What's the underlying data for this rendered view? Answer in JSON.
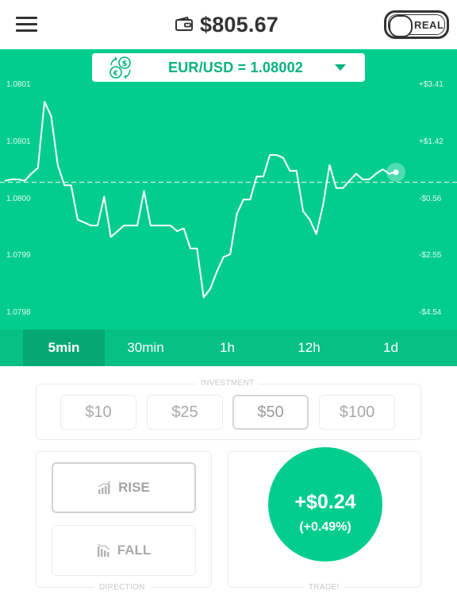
{
  "header": {
    "menu_icon": "hamburger-menu-icon",
    "wallet_icon": "wallet-icon",
    "balance": "$805.67",
    "account_toggle_label": "REAL"
  },
  "pair": {
    "icon": "currency-exchange-icon",
    "label": "EUR/USD = 1.08002",
    "dropdown_icon": "caret-down-icon"
  },
  "chart_data": {
    "type": "line",
    "y_left_ticks": [
      "1.0801",
      "1.0801",
      "1.0800",
      "1.0799",
      "1.0798"
    ],
    "y_right_ticks": [
      "+$3.41",
      "+$1.42",
      "-$0.56",
      "-$2.55",
      "-$4.54"
    ],
    "y_right_values": [
      3.41,
      1.42,
      -0.56,
      -2.55,
      -4.54
    ],
    "entry_level": "dashed",
    "series": [
      {
        "values": [
          0.05,
          0.1,
          0.1,
          0.05,
          0.3,
          0.5,
          2.8,
          2.3,
          0.6,
          -0.1,
          -0.1,
          -1.3,
          -1.4,
          -1.5,
          -1.5,
          -0.5,
          -1.9,
          -1.7,
          -1.5,
          -1.5,
          -1.5,
          -0.3,
          -1.5,
          -1.5,
          -1.5,
          -1.5,
          -1.7,
          -1.6,
          -2.3,
          -2.3,
          -4.0,
          -3.7,
          -3.1,
          -2.6,
          -2.5,
          -1.1,
          -0.6,
          -0.6,
          0.2,
          0.2,
          0.95,
          0.95,
          0.85,
          0.4,
          0.4,
          -1.0,
          -1.3,
          -1.8,
          -0.8,
          0.6,
          -0.2,
          -0.2,
          0.05,
          0.3,
          0.1,
          0.1,
          0.3,
          0.45,
          0.3,
          0.35
        ]
      }
    ],
    "current_marker": "last-point"
  },
  "timeframes": {
    "items": [
      "5min",
      "30min",
      "1h",
      "12h",
      "1d"
    ],
    "selected": "5min"
  },
  "investment": {
    "label": "INVESTMENT",
    "options": [
      "$10",
      "$25",
      "$50",
      "$100"
    ],
    "selected": "$50"
  },
  "direction": {
    "label": "DIRECTION",
    "rise_label": "RISE",
    "rise_icon": "bar-chart-rising-icon",
    "fall_label": "FALL",
    "fall_icon": "bar-chart-falling-icon",
    "selected": "RISE"
  },
  "trade": {
    "label": "TRADE!",
    "amount": "+$0.24",
    "percent": "(+0.49%)"
  },
  "colors": {
    "chart_bg": "#03cd8e",
    "tab_bar_bg": "#06c085",
    "active_tab_bg": "#05a874",
    "accent_text": "#03b37c",
    "trade_button": "#03cd8e"
  }
}
